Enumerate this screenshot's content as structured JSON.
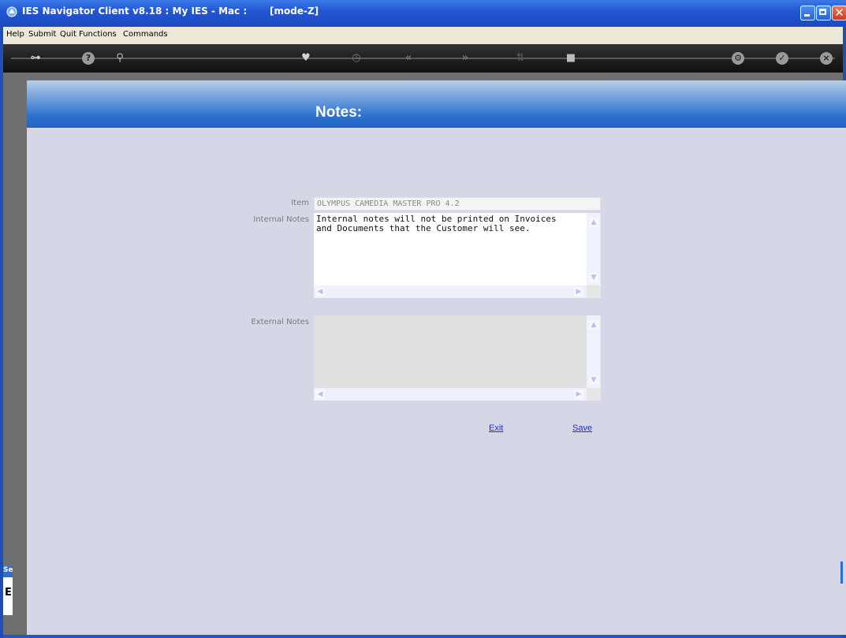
{
  "window": {
    "title": "IES Navigator Client v8.18 : My IES - Mac :",
    "mode": "[mode-Z]"
  },
  "menu": {
    "items": [
      "Help",
      "Submit",
      "Quit",
      "Functions",
      "Commands"
    ]
  },
  "toolbar": {
    "icons": [
      "key-icon",
      "help-icon",
      "search-icon",
      "heart-icon",
      "clock-icon",
      "rewind-icon",
      "fast-forward-icon",
      "sort-icon",
      "stop-icon",
      "settings-icon",
      "check-icon",
      "close-icon"
    ]
  },
  "page": {
    "header_title": "Notes:"
  },
  "form": {
    "item_label": "Item",
    "item_value": "OLYMPUS CAMEDIA MASTER PRO 4.2",
    "internal_label": "Internal Notes",
    "internal_value": "Internal notes will not be printed on Invoices\nand Documents that the Customer will see.",
    "external_label": "External Notes",
    "external_value": ""
  },
  "actions": {
    "exit_label": "Exit",
    "save_label": "Save"
  },
  "side_panel": {
    "tab_label": "Se",
    "glyph": "E"
  },
  "colors": {
    "title_bar": "#2257d1",
    "header_band": "#1f63c6",
    "content_bg": "#d5d7e7",
    "link": "#2030c8"
  }
}
